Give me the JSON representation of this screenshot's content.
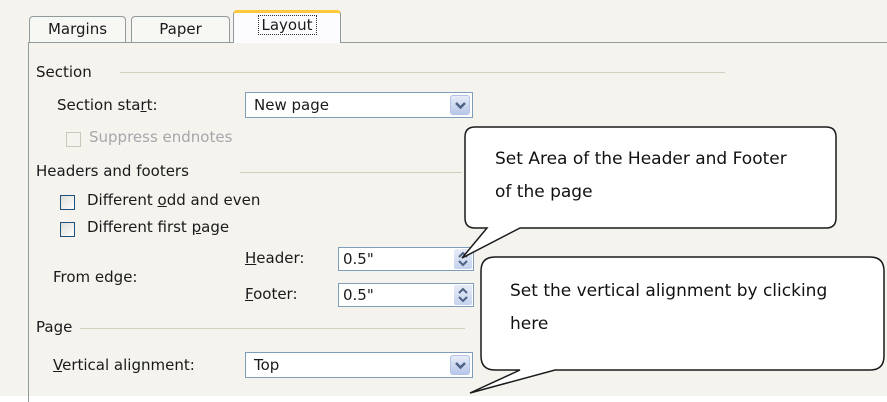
{
  "tabs": [
    "Margins",
    "Paper",
    "Layout"
  ],
  "section": {
    "title": "Section",
    "start_label_pre": "Section sta",
    "start_label_key": "r",
    "start_label_post": "t:",
    "start_value": "New page",
    "suppress_endnotes": "Suppress endnotes"
  },
  "headers_footers": {
    "title": "Headers and footers",
    "odd_even_pre": "Different ",
    "odd_even_key": "o",
    "odd_even_post": "dd and even",
    "first_page_pre": "Different first ",
    "first_page_key": "p",
    "first_page_post": "age",
    "from_edge": "From edge:",
    "header_key": "H",
    "header_rest": "eader:",
    "header_value": "0.5\"",
    "footer_key": "F",
    "footer_rest": "ooter:",
    "footer_value": "0.5\""
  },
  "page": {
    "title": "Page",
    "valign_key": "V",
    "valign_rest": "ertical alignment:",
    "valign_value": "Top"
  },
  "callouts": {
    "header_footer": "Set Area of the Header and Footer of the page",
    "vertical_alignment": "Set the vertical alignment by clicking here"
  },
  "icons": {
    "dropdown": "chevron-down-icon",
    "spinner": "spinner-arrows-icon"
  }
}
